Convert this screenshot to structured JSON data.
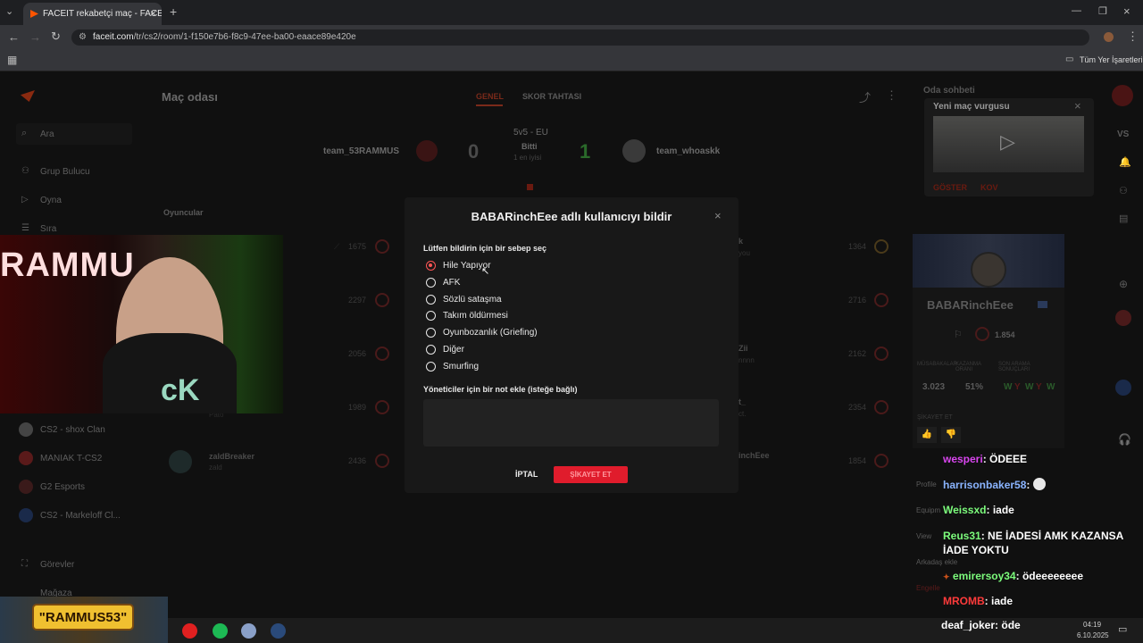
{
  "browser": {
    "tab_title": "FACEIT rekabetçi maç - FACEIT.c",
    "url_host": "faceit.com",
    "url_path": "/tr/cs2/room/1-f150e7b6-f8c9-47ee-ba00-eaace89e420e",
    "bookmarks_label": "Tüm Yer İşaretleri"
  },
  "header": {
    "title": "Maç odası",
    "tab_overview": "GENEL",
    "tab_scoreboard": "SKOR TAHTASI",
    "room_chat": "Oda sohbeti"
  },
  "sidebar": {
    "search": "Ara",
    "items": [
      "Grup Bulucu",
      "Oyna",
      "Sıra"
    ],
    "clubs": [
      "CS2 - shox Clan",
      "MANIAK T-CS2",
      "G2 Esports",
      "CS2 - Markeloff Cl..."
    ],
    "tasks": "Görevler",
    "shop": "Mağaza"
  },
  "match": {
    "team1": "team_53RAMMUS",
    "team2": "team_whoaskk",
    "score1": "0",
    "score2": "1",
    "format": "5v5 - EU",
    "status": "Bitti",
    "best_of": "1 en iyisi",
    "players_label": "Oyuncular"
  },
  "roster_left": {
    "elo": [
      "1675",
      "2297",
      "2056",
      "1989",
      "2436"
    ],
    "last_name": "zaldBreaker",
    "last_sub": "zald",
    "partial_sub": "Pato"
  },
  "roster_right": {
    "elo": [
      "1364",
      "2716",
      "2162",
      "2354",
      "1854"
    ],
    "partial": [
      "k",
      "Zii",
      "t_",
      "inchEee"
    ],
    "partial_sub": [
      "you",
      "nnnn",
      "ct."
    ]
  },
  "modal": {
    "title": "BABARinchEee adlı kullanıcıyı bildir",
    "reason_prompt": "Lütfen bildirin için bir sebep seç",
    "reasons": [
      "Hile Yapıyor",
      "AFK",
      "Sözlü sataşma",
      "Takım öldürmesi",
      "Oyunbozanlık (Griefing)",
      "Diğer",
      "Smurfing"
    ],
    "selected_reason": "Hile Yapıyor",
    "note_label": "Yöneticiler için bir not ekle (isteğe bağlı)",
    "cancel": "İPTAL",
    "submit": "ŞİKAYET ET"
  },
  "highlight": {
    "title": "Yeni maç vurgusu",
    "show": "GÖSTER",
    "dismiss": "KOV"
  },
  "profile": {
    "name": "BABARinchEee",
    "elo": "1.854",
    "matches_label": "MÜSABAKALAR",
    "winrate_label": "KAZANMA ORANI",
    "recent_label": "SON ARAMA SONUÇLARI",
    "matches": "3.023",
    "winrate": "51%",
    "recent": [
      "W",
      "Y",
      "W",
      "Y",
      "W"
    ],
    "report_label": "ŞİKAYET ET"
  },
  "chat": [
    {
      "user": "wesperi",
      "msg": "ÖDEEE",
      "color": "#d946ef"
    },
    {
      "user": "harrisonbaker58",
      "msg": "",
      "color": "#8ab4ff"
    },
    {
      "user": "Weissxd",
      "msg": "iade",
      "color": "#7cfc7c"
    },
    {
      "user": "Reus31",
      "msg": "NE İADESİ AMK KAZANSA İADE YOKTU",
      "color": "#7cfc7c"
    },
    {
      "user": "emirersoy34",
      "msg": "ödeeeeeeee",
      "color": "#7cfc7c"
    },
    {
      "user": "MROMB",
      "msg": "iade",
      "color": "#ff3b3b"
    },
    {
      "user": "deaf_joker",
      "msg": "öde",
      "color": "#ffffff"
    }
  ],
  "chat_side_labels": [
    "Profile",
    "Equipm",
    "View",
    "Arkadaş ekle",
    "Engelle"
  ],
  "stream": {
    "webcam_text": "RAMMU",
    "banner": "\"RAMMUS53\""
  },
  "taskbar": {
    "time": "04:19",
    "date": "6.10.2025"
  },
  "colors": {
    "accent": "#ff5500",
    "report_red": "#e01c2c",
    "win_green": "#3ec93e"
  }
}
